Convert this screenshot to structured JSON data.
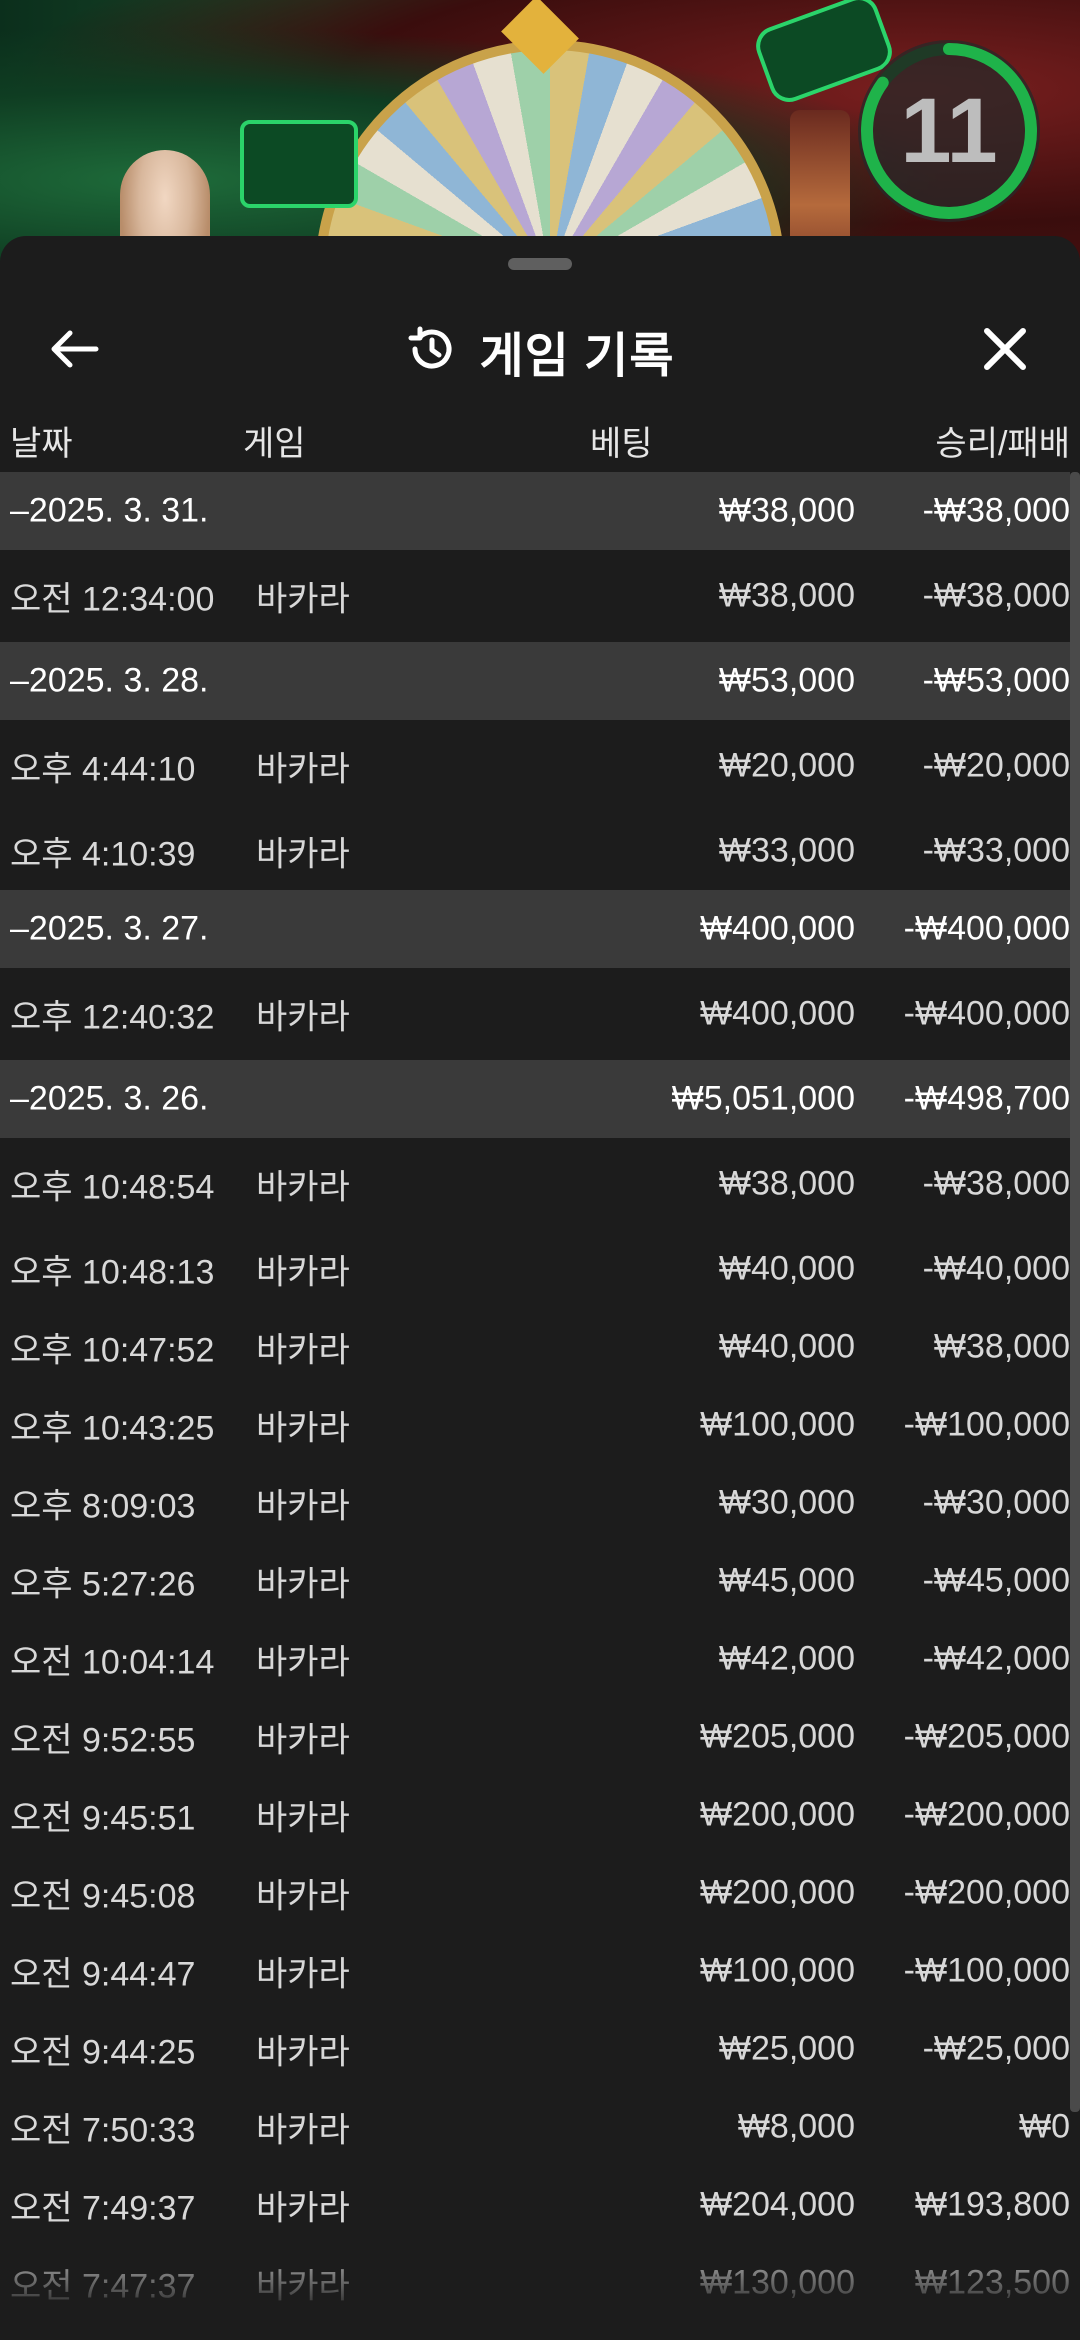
{
  "timer": {
    "value": "11",
    "progress": 0.85,
    "color": "#1fb34a"
  },
  "header": {
    "title": "게임 기록",
    "back_icon": "arrow-left-icon",
    "history_icon": "history-clock-icon",
    "close_icon": "close-x-icon"
  },
  "columns": {
    "date": "날짜",
    "game": "게임",
    "bet": "베팅",
    "win": "승리/패배"
  },
  "rows": [
    {
      "type": "date",
      "date": "–2025. 3. 31.",
      "bet": "₩38,000",
      "win": "-₩38,000"
    },
    {
      "type": "entry",
      "date": "오전 12:34:00",
      "game": "바카라",
      "bet": "₩38,000",
      "win": "-₩38,000"
    },
    {
      "type": "date",
      "date": "–2025. 3. 28.",
      "bet": "₩53,000",
      "win": "-₩53,000"
    },
    {
      "type": "entry",
      "date": "오후 4:44:10",
      "game": "바카라",
      "bet": "₩20,000",
      "win": "-₩20,000"
    },
    {
      "type": "entry",
      "date": "오후 4:10:39",
      "game": "바카라",
      "bet": "₩33,000",
      "win": "-₩33,000"
    },
    {
      "type": "date",
      "date": "–2025. 3. 27.",
      "bet": "₩400,000",
      "win": "-₩400,000"
    },
    {
      "type": "entry",
      "date": "오후 12:40:32",
      "game": "바카라",
      "bet": "₩400,000",
      "win": "-₩400,000"
    },
    {
      "type": "date",
      "date": "–2025. 3. 26.",
      "bet": "₩5,051,000",
      "win": "-₩498,700"
    },
    {
      "type": "entry",
      "date": "오후 10:48:54",
      "game": "바카라",
      "bet": "₩38,000",
      "win": "-₩38,000"
    },
    {
      "type": "entry",
      "date": "오후 10:48:13",
      "game": "바카라",
      "bet": "₩40,000",
      "win": "-₩40,000"
    },
    {
      "type": "entry",
      "date": "오후 10:47:52",
      "game": "바카라",
      "bet": "₩40,000",
      "win": "₩38,000"
    },
    {
      "type": "entry",
      "date": "오후 10:43:25",
      "game": "바카라",
      "bet": "₩100,000",
      "win": "-₩100,000"
    },
    {
      "type": "entry",
      "date": "오후 8:09:03",
      "game": "바카라",
      "bet": "₩30,000",
      "win": "-₩30,000"
    },
    {
      "type": "entry",
      "date": "오후 5:27:26",
      "game": "바카라",
      "bet": "₩45,000",
      "win": "-₩45,000"
    },
    {
      "type": "entry",
      "date": "오전 10:04:14",
      "game": "바카라",
      "bet": "₩42,000",
      "win": "-₩42,000"
    },
    {
      "type": "entry",
      "date": "오전 9:52:55",
      "game": "바카라",
      "bet": "₩205,000",
      "win": "-₩205,000"
    },
    {
      "type": "entry",
      "date": "오전 9:45:51",
      "game": "바카라",
      "bet": "₩200,000",
      "win": "-₩200,000"
    },
    {
      "type": "entry",
      "date": "오전 9:45:08",
      "game": "바카라",
      "bet": "₩200,000",
      "win": "-₩200,000"
    },
    {
      "type": "entry",
      "date": "오전 9:44:47",
      "game": "바카라",
      "bet": "₩100,000",
      "win": "-₩100,000"
    },
    {
      "type": "entry",
      "date": "오전 9:44:25",
      "game": "바카라",
      "bet": "₩25,000",
      "win": "-₩25,000"
    },
    {
      "type": "entry",
      "date": "오전 7:50:33",
      "game": "바카라",
      "bet": "₩8,000",
      "win": "₩0"
    },
    {
      "type": "entry",
      "date": "오전 7:49:37",
      "game": "바카라",
      "bet": "₩204,000",
      "win": "₩193,800"
    },
    {
      "type": "entry",
      "date": "오전 7:47:37",
      "game": "바카라",
      "bet": "₩130,000",
      "win": "₩123,500"
    }
  ]
}
